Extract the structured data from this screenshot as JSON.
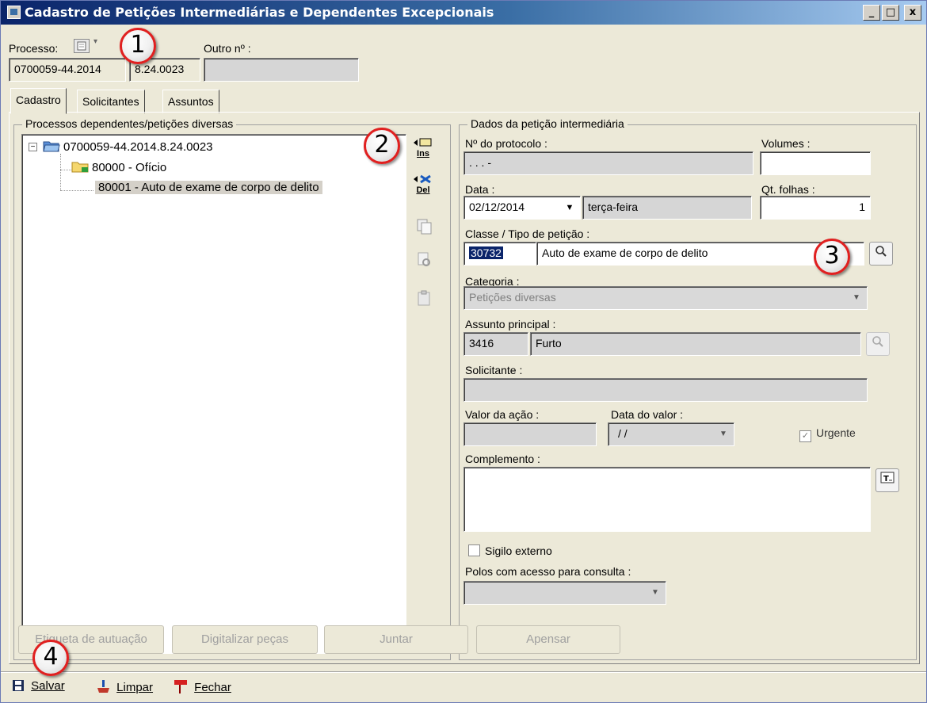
{
  "window": {
    "title": "Cadastro de Petições Intermediárias e Dependentes Excepcionais",
    "controls": {
      "minimize": "_",
      "maximize": "□",
      "close": "x"
    }
  },
  "header": {
    "processo_label": "Processo:",
    "processo_part1": "0700059-44.2014",
    "processo_part2": "8.24.0023",
    "outro_label": "Outro nº :",
    "outro_value": ""
  },
  "tabs": [
    {
      "label": "Cadastro",
      "active": true
    },
    {
      "label": "Solicitantes",
      "active": false
    },
    {
      "label": "Assuntos",
      "active": false
    }
  ],
  "left_panel": {
    "title": "Processos dependentes/petições diversas",
    "tree": [
      {
        "label": "0700059-44.2014.8.24.0023",
        "level": 0
      },
      {
        "label": "80000 - Ofício",
        "level": 1
      },
      {
        "label": "80001 - Auto de exame de corpo de delito",
        "level": 2,
        "selected": true
      }
    ],
    "tools": {
      "insert_label": "Ins",
      "delete_label": "Del"
    }
  },
  "right_panel": {
    "title": "Dados da petição intermediária",
    "protocolo_label": "Nº do protocolo :",
    "protocolo_value": ". . .          -",
    "volumes_label": "Volumes :",
    "volumes_value": "",
    "data_label": "Data :",
    "data_value": "02/12/2014",
    "dia_semana": "terça-feira",
    "folhas_label": "Qt. folhas :",
    "folhas_value": "1",
    "classe_label": "Classe / Tipo de petição :",
    "classe_code": "30732",
    "classe_desc": "Auto de exame de corpo de delito",
    "categoria_label": "Categoria :",
    "categoria_value": "Petições diversas",
    "assunto_label": "Assunto principal :",
    "assunto_code": "3416",
    "assunto_desc": "Furto",
    "solicitante_label": "Solicitante :",
    "solicitante_value": "",
    "valor_label": "Valor da ação :",
    "valor_value": "",
    "data_valor_label": "Data do valor :",
    "data_valor_value": "/ /",
    "urgente_label": "Urgente",
    "urgente_checked": true,
    "complemento_label": "Complemento :",
    "complemento_value": "",
    "sigilo_label": "Sigilo externo",
    "sigilo_checked": false,
    "polos_label": "Polos com acesso para consulta :",
    "polos_value": ""
  },
  "bottom_buttons": {
    "etiqueta": "Etiqueta de autuação",
    "digitalizar": "Digitalizar peças",
    "juntar": "Juntar",
    "apensar": "Apensar"
  },
  "toolbar": {
    "salvar": "Salvar",
    "limpar": "Limpar",
    "fechar": "Fechar"
  },
  "badges": [
    "1",
    "2",
    "3",
    "4"
  ],
  "colors": {
    "badge_border": "#e02020",
    "selection": "#d4d0c8",
    "title_gradient_start": "#0a246a"
  }
}
